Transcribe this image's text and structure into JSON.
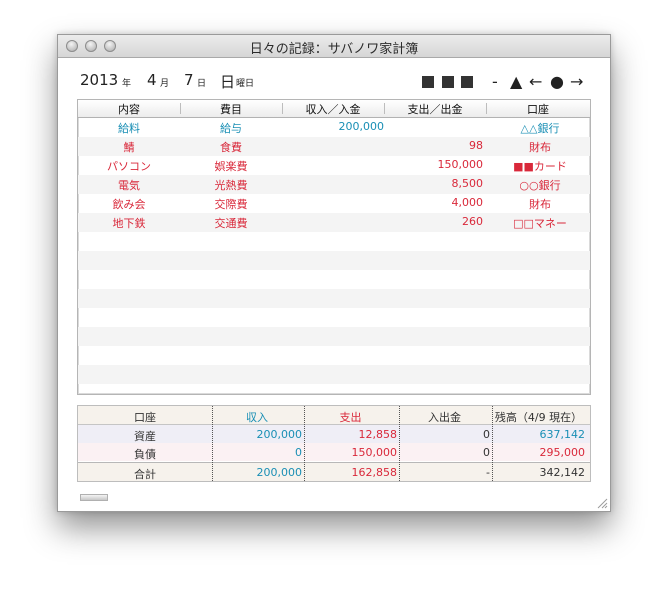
{
  "window": {
    "title": "日々の記録：サバノワ家計簿"
  },
  "date": {
    "year": "2013",
    "year_unit": "年",
    "month": "4",
    "month_unit": "月",
    "day": "7",
    "day_unit": "日",
    "weekday": "日",
    "weekday_unit": "曜日"
  },
  "nav": {
    "dash": "-",
    "triangle": "▲",
    "left_arrow": "←",
    "circle": "●",
    "right_arrow": "→"
  },
  "list": {
    "headers": [
      "内容",
      "費目",
      "収入／入金",
      "支出／出金",
      "口座"
    ],
    "rows": [
      {
        "content": "給料",
        "category": "給与",
        "income": "200,000",
        "expense": "",
        "account": "△△銀行",
        "color": "#1a8fb5"
      },
      {
        "content": "鯖",
        "category": "食費",
        "income": "",
        "expense": "98",
        "account": "財布",
        "color": "#d9283a"
      },
      {
        "content": "パソコン",
        "category": "娯楽費",
        "income": "",
        "expense": "150,000",
        "account": "■■カード",
        "color": "#d9283a"
      },
      {
        "content": "電気",
        "category": "光熱費",
        "income": "",
        "expense": "8,500",
        "account": "○○銀行",
        "color": "#d9283a"
      },
      {
        "content": "飲み会",
        "category": "交際費",
        "income": "",
        "expense": "4,000",
        "account": "財布",
        "color": "#d9283a"
      },
      {
        "content": "地下鉄",
        "category": "交通費",
        "income": "",
        "expense": "260",
        "account": "□□マネー",
        "color": "#d9283a"
      }
    ]
  },
  "summary": {
    "headers": {
      "account": "口座",
      "income": "収入",
      "expense": "支出",
      "transfer": "入出金",
      "balance": "残高（4/9 現在）"
    },
    "assets": {
      "label": "資産",
      "income": "200,000",
      "expense": "12,858",
      "transfer": "0",
      "balance": "637,142"
    },
    "liabilities": {
      "label": "負債",
      "income": "0",
      "expense": "150,000",
      "transfer": "0",
      "balance": "295,000"
    },
    "total": {
      "label": "合計",
      "income": "200,000",
      "expense": "162,858",
      "transfer": "-",
      "balance": "342,142"
    }
  },
  "colors": {
    "income": "#1a8fb5",
    "expense": "#d9283a",
    "text": "#333333"
  }
}
